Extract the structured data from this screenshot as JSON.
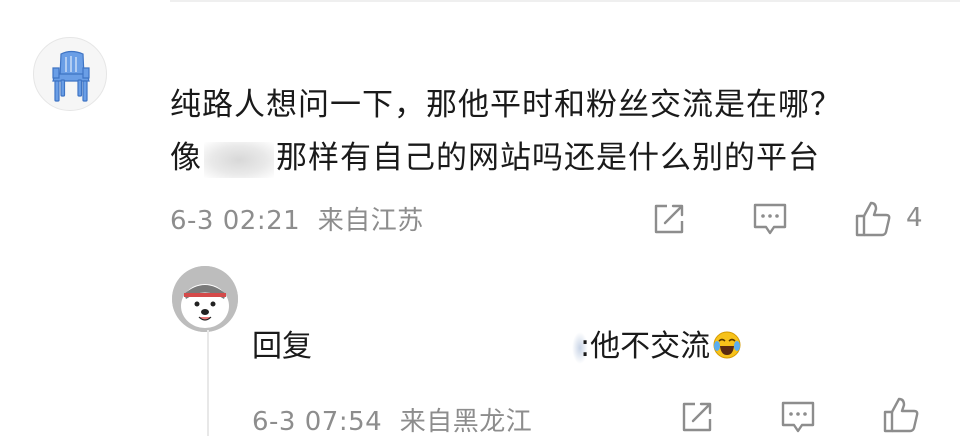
{
  "main_comment": {
    "avatar": "blue-chair-avatar",
    "line1": "纯路人想问一下，那他平时和粉丝交流是在哪？",
    "line2_prefix": "像",
    "line2_suffix": "那样有自己的网站吗还是什么别的平台",
    "date": "6-3 02:21",
    "location": "来自江苏",
    "like_count": "4"
  },
  "reply": {
    "avatar": "samoyed-dog-avatar",
    "prefix": "回复",
    "body": ":他不交流",
    "emoji": "laughing-crying-emoji",
    "date": "6-3 07:54",
    "location": "来自黑龙江"
  },
  "icons": {
    "share": "share-icon",
    "comment": "comment-icon",
    "like": "thumbs-up-icon"
  },
  "colors": {
    "text": "#1a1a1a",
    "meta": "#8d8d8d",
    "avatar_chair": "#5b8fdc"
  }
}
